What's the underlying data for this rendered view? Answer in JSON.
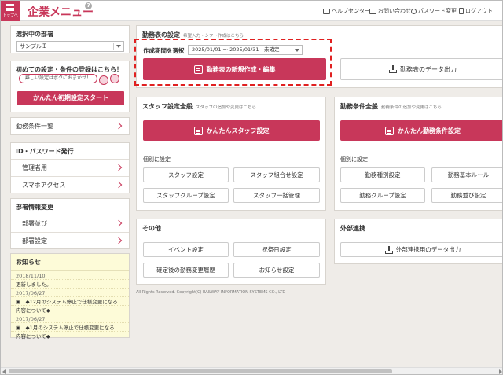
{
  "header": {
    "top_button_label": "トップへ",
    "title": "企業メニュー",
    "help_glyph": "?",
    "nav": [
      {
        "label": "ヘルプセンター",
        "icon": "book-icon"
      },
      {
        "label": "お問い合わせ",
        "icon": "mail-icon"
      },
      {
        "label": "パスワード変更",
        "icon": "key-icon"
      },
      {
        "label": "ログアウト",
        "icon": "lock-icon"
      }
    ]
  },
  "sidebar": {
    "dept": {
      "title": "選択中の部署",
      "value": "サンプルＩ"
    },
    "first_setup": {
      "title": "初めての設定・条件の登録はこちら！",
      "bubble": "難しい設定はボクにおまかせ！",
      "button": "かんたん初期設定スタート"
    },
    "work_conditions": "勤務条件一覧",
    "id_password": {
      "title": "ID・パスワード発行",
      "items": [
        "管理者用",
        "スマホアクセス"
      ]
    },
    "dept_info": {
      "title": "部署情報変更",
      "items": [
        "部署並び",
        "部署設定"
      ]
    },
    "news": {
      "title": "お知らせ",
      "lines": [
        {
          "text": "2018/11/10",
          "kind": "date"
        },
        {
          "text": "更新しました。",
          "kind": "text"
        },
        {
          "text": "2017/06/27",
          "kind": "date"
        },
        {
          "text": "▣　◆12月のシステム停止で仕様変更になる",
          "kind": "text"
        },
        {
          "text": "内容について◆",
          "kind": "text"
        },
        {
          "text": "2017/06/27",
          "kind": "date"
        },
        {
          "text": "▣　◆1月のシステム停止で仕様変更になる",
          "kind": "text"
        },
        {
          "text": "内容について◆",
          "kind": "text"
        }
      ]
    }
  },
  "schedule": {
    "title": "勤務表の設定",
    "subtitle": "希望入力・シフト作成はこちら",
    "period_label": "作成期間を選択",
    "period_value": "2025/01/01 ～ 2025/01/31",
    "period_status": "未確定",
    "create_button": "勤務表の新規作成・編集",
    "download_button": "勤務表のデータ出力"
  },
  "staff": {
    "title": "スタッフ設定全般",
    "subtitle": "スタッフの追加や変更はこちら",
    "easy_button": "かんたんスタッフ設定",
    "individual": "個別に設定",
    "buttons": [
      "スタッフ設定",
      "スタッフ組合せ設定",
      "スタッフグループ設定",
      "スタッフ一括管理"
    ]
  },
  "conditions": {
    "title": "勤務条件全般",
    "subtitle": "勤務条件の追加や変更はこちら",
    "easy_button": "かんたん勤務条件設定",
    "individual": "個別に設定",
    "buttons": [
      "勤務種別設定",
      "勤務基本ルール",
      "勤務グループ設定",
      "勤務並び設定"
    ]
  },
  "other": {
    "title": "その他",
    "buttons": [
      "イベント設定",
      "祝祭日設定",
      "確定後の勤務変更履歴",
      "お知らせ設定"
    ]
  },
  "external": {
    "title": "外部連携",
    "button": "外部連携用のデータ出力"
  },
  "footer": "All Rights Reserved. Copyright(C) RAILWAY INFORMATION SYSTEMS CO., LTD",
  "colors": {
    "accent": "#c8375a",
    "highlight": "#e02020",
    "background": "#efece8"
  }
}
